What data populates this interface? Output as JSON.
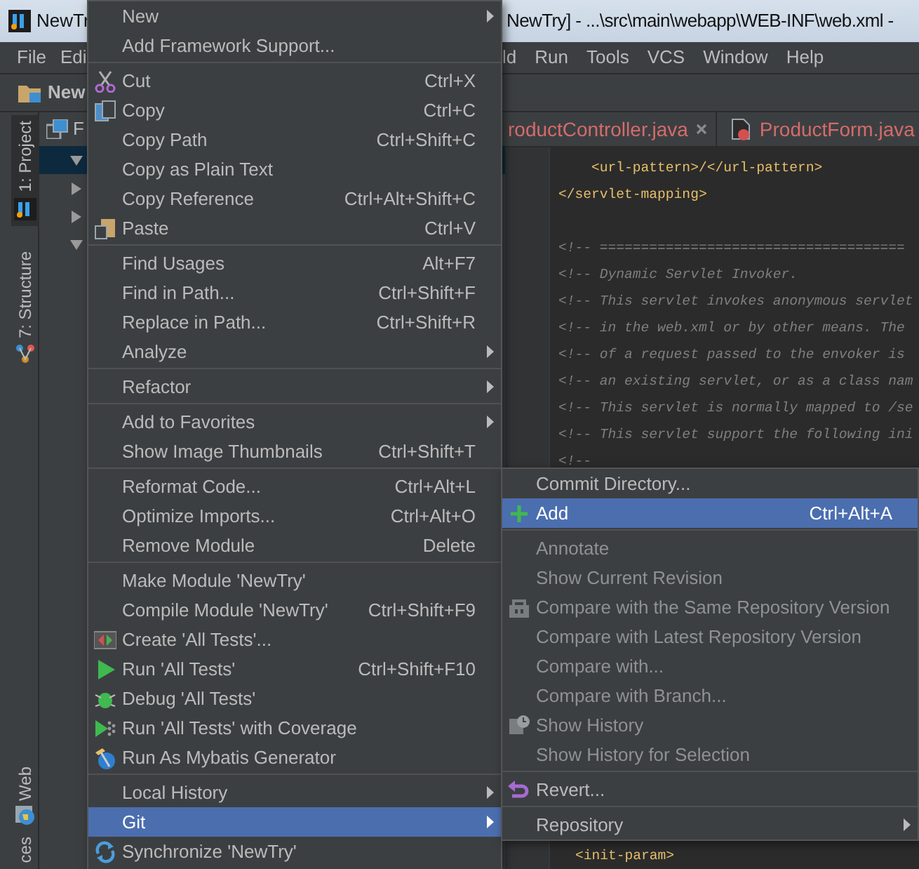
{
  "title_bar": {
    "left_text": "NewTr",
    "right_text": "NewTry] - ...\\src\\main\\webapp\\WEB-INF\\web.xml -"
  },
  "menu_bar": {
    "left": [
      "File",
      "Edi"
    ],
    "right": [
      "ld",
      "Run",
      "Tools",
      "VCS",
      "Window",
      "Help"
    ]
  },
  "toolbar": {
    "project": "New"
  },
  "tool_strip": [
    {
      "label": "1: Project",
      "selected": true
    },
    {
      "label": "7: Structure",
      "selected": false
    },
    {
      "label": "Web",
      "selected": false
    },
    {
      "label": "ces",
      "selected": false
    }
  ],
  "project_panel": {
    "header": "F",
    "rows": [
      {
        "expanded": true,
        "selected": true
      },
      {
        "expanded": false,
        "selected": false
      },
      {
        "expanded": false,
        "selected": false
      },
      {
        "expanded": true,
        "selected": false
      }
    ]
  },
  "editor": {
    "tabs": [
      "roductController.java",
      "ProductForm.java"
    ],
    "lines": [
      {
        "kind": "tag",
        "text": "    <url-pattern>/</url-pattern>"
      },
      {
        "kind": "tag",
        "text": "</servlet-mapping>"
      },
      {
        "kind": "blank"
      },
      {
        "kind": "comment",
        "text": "<!-- ====================================="
      },
      {
        "kind": "comment",
        "text": "<!-- Dynamic Servlet Invoker."
      },
      {
        "kind": "comment",
        "text": "<!-- This servlet invokes anonymous servlet"
      },
      {
        "kind": "comment",
        "text": "<!-- in the web.xml or by other means. The"
      },
      {
        "kind": "comment",
        "text": "<!-- of a request passed to the envoker is"
      },
      {
        "kind": "comment",
        "text": "<!-- an existing servlet, or as a class nam"
      },
      {
        "kind": "comment",
        "text": "<!-- This servlet is normally mapped to /se"
      },
      {
        "kind": "comment",
        "text": "<!-- This servlet support the following ini"
      },
      {
        "kind": "comment",
        "text": "<!--"
      }
    ],
    "bottom_line": {
      "kind": "tag",
      "text": "<init-param>"
    }
  },
  "context_menu": [
    {
      "kind": "item",
      "label": "New",
      "submenu": true,
      "selected": false
    },
    {
      "kind": "item",
      "label": "Add Framework Support...",
      "submenu": false,
      "selected": false
    },
    {
      "kind": "separator"
    },
    {
      "kind": "item",
      "label": "Cut",
      "shortcut": "Ctrl+X",
      "submenu": false,
      "selected": false
    },
    {
      "kind": "item",
      "label": "Copy",
      "shortcut": "Ctrl+C",
      "submenu": false,
      "selected": false
    },
    {
      "kind": "item",
      "label": "Copy Path",
      "shortcut": "Ctrl+Shift+C",
      "submenu": false,
      "selected": false
    },
    {
      "kind": "item",
      "label": "Copy as Plain Text",
      "submenu": false,
      "selected": false
    },
    {
      "kind": "item",
      "label": "Copy Reference",
      "shortcut": "Ctrl+Alt+Shift+C",
      "submenu": false,
      "selected": false
    },
    {
      "kind": "item",
      "label": "Paste",
      "shortcut": "Ctrl+V",
      "submenu": false,
      "selected": false
    },
    {
      "kind": "separator"
    },
    {
      "kind": "item",
      "label": "Find Usages",
      "shortcut": "Alt+F7",
      "submenu": false,
      "selected": false
    },
    {
      "kind": "item",
      "label": "Find in Path...",
      "shortcut": "Ctrl+Shift+F",
      "submenu": false,
      "selected": false
    },
    {
      "kind": "item",
      "label": "Replace in Path...",
      "shortcut": "Ctrl+Shift+R",
      "submenu": false,
      "selected": false
    },
    {
      "kind": "item",
      "label": "Analyze",
      "submenu": true,
      "selected": false
    },
    {
      "kind": "separator"
    },
    {
      "kind": "item",
      "label": "Refactor",
      "submenu": true,
      "selected": false
    },
    {
      "kind": "separator"
    },
    {
      "kind": "item",
      "label": "Add to Favorites",
      "submenu": true,
      "selected": false
    },
    {
      "kind": "item",
      "label": "Show Image Thumbnails",
      "shortcut": "Ctrl+Shift+T",
      "submenu": false,
      "selected": false
    },
    {
      "kind": "separator"
    },
    {
      "kind": "item",
      "label": "Reformat Code...",
      "shortcut": "Ctrl+Alt+L",
      "submenu": false,
      "selected": false
    },
    {
      "kind": "item",
      "label": "Optimize Imports...",
      "shortcut": "Ctrl+Alt+O",
      "submenu": false,
      "selected": false
    },
    {
      "kind": "item",
      "label": "Remove Module",
      "shortcut": "Delete",
      "submenu": false,
      "selected": false
    },
    {
      "kind": "separator"
    },
    {
      "kind": "item",
      "label": "Make Module 'NewTry'",
      "submenu": false,
      "selected": false
    },
    {
      "kind": "item",
      "label": "Compile Module 'NewTry'",
      "shortcut": "Ctrl+Shift+F9",
      "submenu": false,
      "selected": false
    },
    {
      "kind": "item",
      "label": "Create 'All Tests'...",
      "submenu": false,
      "selected": false
    },
    {
      "kind": "item",
      "label": "Run 'All Tests'",
      "shortcut": "Ctrl+Shift+F10",
      "submenu": false,
      "selected": false
    },
    {
      "kind": "item",
      "label": "Debug 'All Tests'",
      "submenu": false,
      "selected": false
    },
    {
      "kind": "item",
      "label": "Run 'All Tests' with Coverage",
      "submenu": false,
      "selected": false
    },
    {
      "kind": "item",
      "label": "Run As Mybatis Generator",
      "submenu": false,
      "selected": false
    },
    {
      "kind": "separator"
    },
    {
      "kind": "item",
      "label": "Local History",
      "submenu": true,
      "selected": false
    },
    {
      "kind": "item",
      "label": "Git",
      "submenu": true,
      "selected": true
    },
    {
      "kind": "item",
      "label": "Synchronize 'NewTry'",
      "submenu": false,
      "selected": false
    }
  ],
  "git_menu": [
    {
      "kind": "item",
      "label": "Commit Directory...",
      "submenu": false,
      "selected": false,
      "disabled": false
    },
    {
      "kind": "item",
      "label": "Add",
      "shortcut": "Ctrl+Alt+A",
      "submenu": false,
      "selected": true,
      "disabled": false
    },
    {
      "kind": "separator"
    },
    {
      "kind": "item",
      "label": "Annotate",
      "submenu": false,
      "selected": false,
      "disabled": true
    },
    {
      "kind": "item",
      "label": "Show Current Revision",
      "submenu": false,
      "selected": false,
      "disabled": true
    },
    {
      "kind": "item",
      "label": "Compare with the Same Repository Version",
      "submenu": false,
      "selected": false,
      "disabled": true
    },
    {
      "kind": "item",
      "label": "Compare with Latest Repository Version",
      "submenu": false,
      "selected": false,
      "disabled": true
    },
    {
      "kind": "item",
      "label": "Compare with...",
      "submenu": false,
      "selected": false,
      "disabled": true
    },
    {
      "kind": "item",
      "label": "Compare with Branch...",
      "submenu": false,
      "selected": false,
      "disabled": true
    },
    {
      "kind": "item",
      "label": "Show History",
      "submenu": false,
      "selected": false,
      "disabled": true
    },
    {
      "kind": "item",
      "label": "Show History for Selection",
      "submenu": false,
      "selected": false,
      "disabled": true
    },
    {
      "kind": "separator"
    },
    {
      "kind": "item",
      "label": "Revert...",
      "submenu": false,
      "selected": false,
      "disabled": false
    },
    {
      "kind": "separator"
    },
    {
      "kind": "item",
      "label": "Repository",
      "submenu": true,
      "selected": false,
      "disabled": false
    }
  ]
}
